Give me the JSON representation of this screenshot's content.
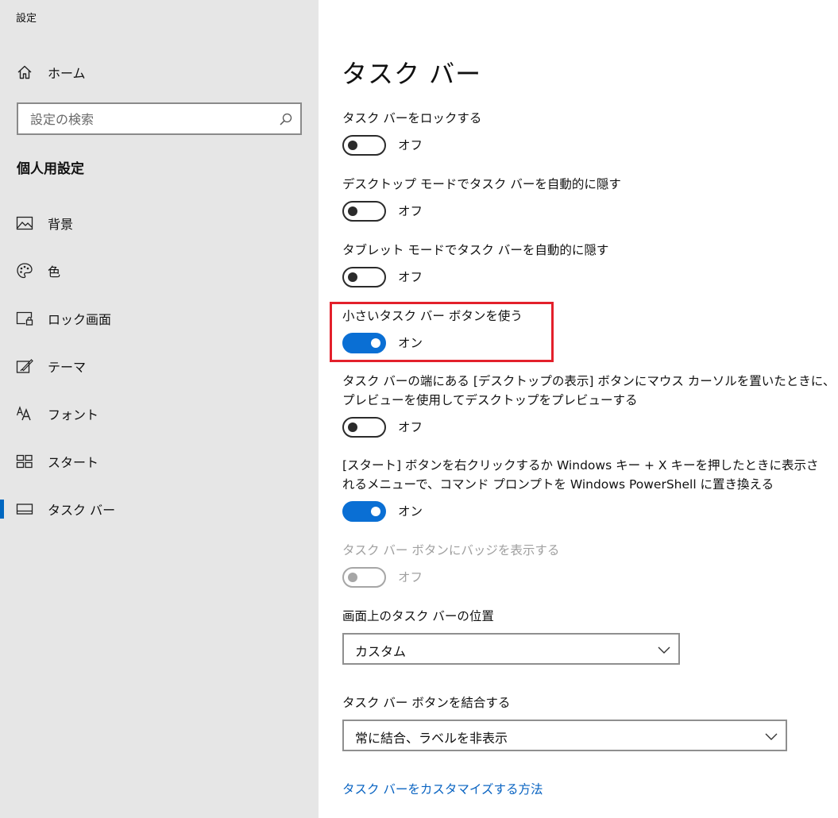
{
  "app": {
    "title": "設定"
  },
  "sidebar": {
    "home_label": "ホーム",
    "search_placeholder": "設定の検索",
    "section_heading": "個人用設定",
    "items": [
      {
        "label": "背景",
        "icon": "picture-icon",
        "selected": false
      },
      {
        "label": "色",
        "icon": "palette-icon",
        "selected": false
      },
      {
        "label": "ロック画面",
        "icon": "lock-screen-icon",
        "selected": false
      },
      {
        "label": "テーマ",
        "icon": "theme-icon",
        "selected": false
      },
      {
        "label": "フォント",
        "icon": "font-icon",
        "selected": false
      },
      {
        "label": "スタート",
        "icon": "start-icon",
        "selected": false
      },
      {
        "label": "タスク バー",
        "icon": "taskbar-icon",
        "selected": true
      }
    ]
  },
  "main": {
    "title": "タスク バー",
    "settings": [
      {
        "label": "タスク バーをロックする",
        "state": "オフ",
        "on": false,
        "disabled": false
      },
      {
        "label": "デスクトップ モードでタスク バーを自動的に隠す",
        "state": "オフ",
        "on": false,
        "disabled": false
      },
      {
        "label": "タブレット モードでタスク バーを自動的に隠す",
        "state": "オフ",
        "on": false,
        "disabled": false
      },
      {
        "label": "小さいタスク バー ボタンを使う",
        "state": "オン",
        "on": true,
        "disabled": false
      },
      {
        "label_line1": "タスク バーの端にある [デスクトップの表示] ボタンにマウス カーソルを置いたときに、",
        "label_line2": "プレビューを使用してデスクトップをプレビューする",
        "state": "オフ",
        "on": false,
        "disabled": false
      },
      {
        "label_line1": "[スタート] ボタンを右クリックするか Windows キー + X キーを押したときに表示さ",
        "label_line2": "れるメニューで、コマンド プロンプトを Windows PowerShell に置き換える",
        "state": "オン",
        "on": true,
        "disabled": false
      },
      {
        "label": "タスク バー ボタンにバッジを表示する",
        "state": "オフ",
        "on": false,
        "disabled": true
      }
    ],
    "position": {
      "label": "画面上のタスク バーの位置",
      "value": "カスタム"
    },
    "combine": {
      "label": "タスク バー ボタンを結合する",
      "value": "常に結合、ラベルを非表示"
    },
    "link": "タスク バーをカスタマイズする方法"
  },
  "colors": {
    "accent": "#0a6fd4",
    "highlight": "#e3202b",
    "sidebar_bg": "#e6e6e6",
    "link": "#0a64c2"
  }
}
